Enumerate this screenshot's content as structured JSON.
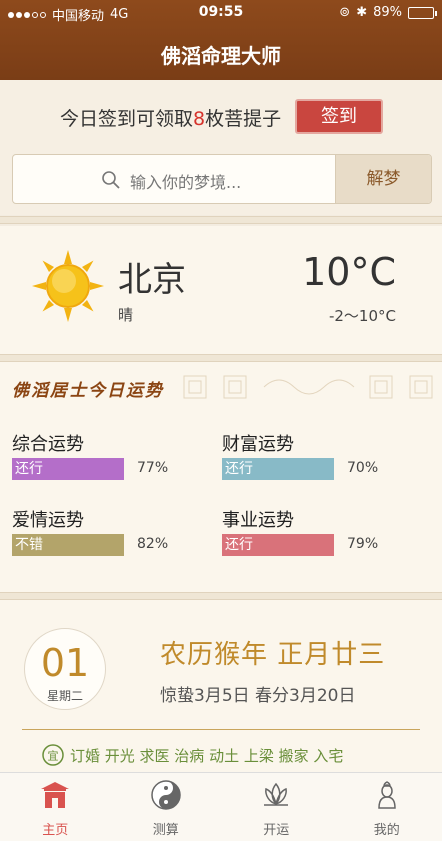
{
  "status": {
    "carrier": "中国移动",
    "network": "4G",
    "time": "09:55",
    "battery": "89%",
    "battery_level": 0.89
  },
  "nav": {
    "title": "佛滔命理大师"
  },
  "signin": {
    "text_before": "今日签到可领取",
    "count": "8",
    "text_after": "枚菩提子",
    "button": "签到"
  },
  "search": {
    "placeholder": "输入你的梦境...",
    "button": "解梦"
  },
  "weather": {
    "city": "北京",
    "condition": "晴",
    "temperature": "10°C",
    "range": "-2～10°C",
    "icon": "sun-icon"
  },
  "fortune": {
    "title": "佛滔居士今日运势",
    "items": [
      {
        "label": "综合运势",
        "status": "还行",
        "percent": "77%",
        "color": "#b46ec9"
      },
      {
        "label": "财富运势",
        "status": "还行",
        "percent": "70%",
        "color": "#88bac7"
      },
      {
        "label": "爱情运势",
        "status": "不错",
        "percent": "82%",
        "color": "#b3a46a"
      },
      {
        "label": "事业运势",
        "status": "还行",
        "percent": "79%",
        "color": "#d9727a"
      }
    ]
  },
  "calendar": {
    "day": "01",
    "weekday": "星期二",
    "lunar": "农历猴年 正月廿三",
    "terms": "惊蛰3月5日  春分3月20日",
    "yi": "订婚 开光 求医 治病 动土 上梁 搬家 入宅"
  },
  "tabs": [
    {
      "label": "主页",
      "icon": "temple-icon",
      "active": true
    },
    {
      "label": "测算",
      "icon": "yin-yang-icon",
      "active": false
    },
    {
      "label": "开运",
      "icon": "lotus-icon",
      "active": false
    },
    {
      "label": "我的",
      "icon": "buddha-icon",
      "active": false
    }
  ],
  "colors": {
    "header": "#8e4a1c",
    "accent": "#c9463f",
    "gold": "#c08a2b"
  }
}
